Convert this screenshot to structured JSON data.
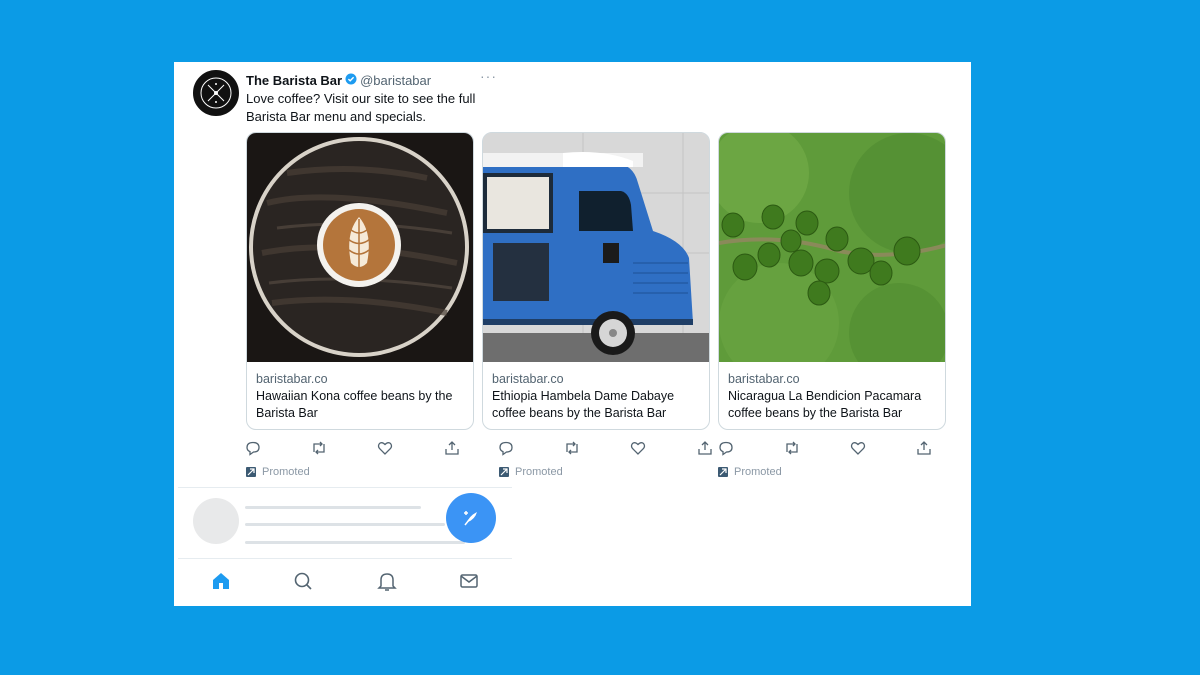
{
  "tweet": {
    "name": "The Barista Bar",
    "handle": "@baristabar",
    "more": "···",
    "text": "Love coffee? Visit our site to see the full Barista Bar menu and specials."
  },
  "cards": [
    {
      "domain": "baristabar.co",
      "title": "Hawaiian Kona coffee beans by the Barista Bar",
      "image": "coffee-latte-art-photo"
    },
    {
      "domain": "baristabar.co",
      "title": "Ethiopia Hambela Dame Dabaye coffee beans by the Barista Bar",
      "image": "blue-food-truck-photo"
    },
    {
      "domain": "baristabar.co",
      "title": "Nicaragua La Bendicion Pacamara coffee beans by the Barista Bar",
      "image": "green-coffee-cherries-photo"
    }
  ],
  "promoted_label": "Promoted",
  "actions": [
    "reply-icon",
    "retweet-icon",
    "like-icon",
    "share-icon"
  ],
  "nav": [
    "home-icon",
    "search-icon",
    "notifications-icon",
    "messages-icon"
  ],
  "colors": {
    "background": "#0b9be6",
    "accent": "#3b94f5",
    "verified": "#1d9bf0",
    "text": "#0f1419",
    "muted": "#536471"
  }
}
